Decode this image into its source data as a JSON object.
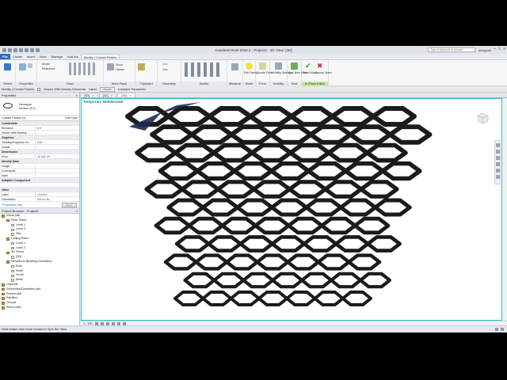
{
  "title": "Autodesk Revit 2016.2 - Project2 - 3D View: {3D}",
  "search_placeholder": "Type a keyword or phrase",
  "user": "designtoi",
  "tabs": [
    "File",
    "Create",
    "Insert",
    "View",
    "Manage",
    "Add-Ins",
    "Modify | Curtain Panels"
  ],
  "ribbon": {
    "select": "Select",
    "properties": "Properties",
    "draw": "Draw",
    "model": "Model",
    "reference": "Reference",
    "workplane": "Work Plane",
    "show": "Show",
    "viewer": "Viewer",
    "set": "Set",
    "clipboard": "Clipboard",
    "paste": "Paste",
    "cut": "Cut",
    "join": "Join",
    "geometry": "Geometry",
    "modify": "Modify",
    "measure": "Measure",
    "mode": "Mode",
    "edit_family": "Edit Family",
    "create_form": "Create Form",
    "form": "Form",
    "visibility_settings": "Visibility Settings",
    "visibility": "Visibility",
    "pick_new_host": "Pick New Host",
    "host": "Host",
    "finish_mass": "Finish Mass",
    "cancel_mass": "Cancel Mass",
    "inplace_editor": "In-Place Editor"
  },
  "optionbar": {
    "modify_label": "Modify | Curtain Panels",
    "moves_with": "Moves With Nearby Elements",
    "label": "Label",
    "label_value": "<None>",
    "instance_param": "Instance Parameter"
  },
  "properties": {
    "title": "Properties",
    "type_family": "Hexagon",
    "type_name": "hamun (F1)",
    "selection": "Curtain Panels (1)",
    "edit_type": "Edit Type",
    "rows": [
      {
        "cat": true,
        "k": "Constraints"
      },
      {
        "k": "Elevation",
        "v": "0.0"
      },
      {
        "k": "Moves With Nearby...",
        "v": ""
      },
      {
        "cat": true,
        "k": "Graphics"
      },
      {
        "k": "Visibility/Graphics Ov...",
        "v": "Edit..."
      },
      {
        "k": "Visible",
        "v": ""
      },
      {
        "cat": true,
        "k": "Dimensions"
      },
      {
        "k": "Area",
        "v": "42.442 m²"
      },
      {
        "cat": true,
        "k": "Identity Data"
      },
      {
        "k": "Image",
        "v": ""
      },
      {
        "k": "Comments",
        "v": ""
      },
      {
        "k": "Mark",
        "v": ""
      },
      {
        "cat": true,
        "k": "Adaptive Component"
      },
      {
        "k": "",
        "v": ""
      },
      {
        "cat": true,
        "k": "Other"
      },
      {
        "k": "Label",
        "v": "<None>"
      },
      {
        "k": "Orientation",
        "v": "Set to Ob..."
      }
    ],
    "help": "Properties help",
    "apply": "Apply"
  },
  "browser": {
    "title": "Project Browser - Project2",
    "nodes": [
      {
        "d": 0,
        "t": "Views (all)"
      },
      {
        "d": 1,
        "t": "Floor Plans"
      },
      {
        "d": 2,
        "t": "Level 1"
      },
      {
        "d": 2,
        "t": "Level 2"
      },
      {
        "d": 2,
        "t": "Site"
      },
      {
        "d": 1,
        "t": "Ceiling Plans"
      },
      {
        "d": 2,
        "t": "Level 1"
      },
      {
        "d": 2,
        "t": "Level 2"
      },
      {
        "d": 1,
        "t": "3D Views"
      },
      {
        "d": 2,
        "t": "{3D}"
      },
      {
        "d": 1,
        "t": "Elevations (Building Elevation)"
      },
      {
        "d": 2,
        "t": "East"
      },
      {
        "d": 2,
        "t": "North"
      },
      {
        "d": 2,
        "t": "South"
      },
      {
        "d": 2,
        "t": "West"
      },
      {
        "d": 0,
        "t": "Legends"
      },
      {
        "d": 0,
        "t": "Schedules/Quantities (all)"
      },
      {
        "d": 0,
        "t": "Sheets (all)"
      },
      {
        "d": 0,
        "t": "Families"
      },
      {
        "d": 0,
        "t": "Groups"
      },
      {
        "d": 0,
        "t": "Revit Links"
      }
    ]
  },
  "viewtabs": [
    "{3D}",
    "{3D}",
    "{3D}"
  ],
  "canvas_label": "Temporary Hide/Isolate",
  "viewbar_scale": "1 : 100",
  "status": "Hold button and move mouse to Spin the View",
  "colors": {
    "accent": "#2f6bbf",
    "highlight": "#2ec4d8",
    "edit_mode": "#c7e8a4"
  }
}
